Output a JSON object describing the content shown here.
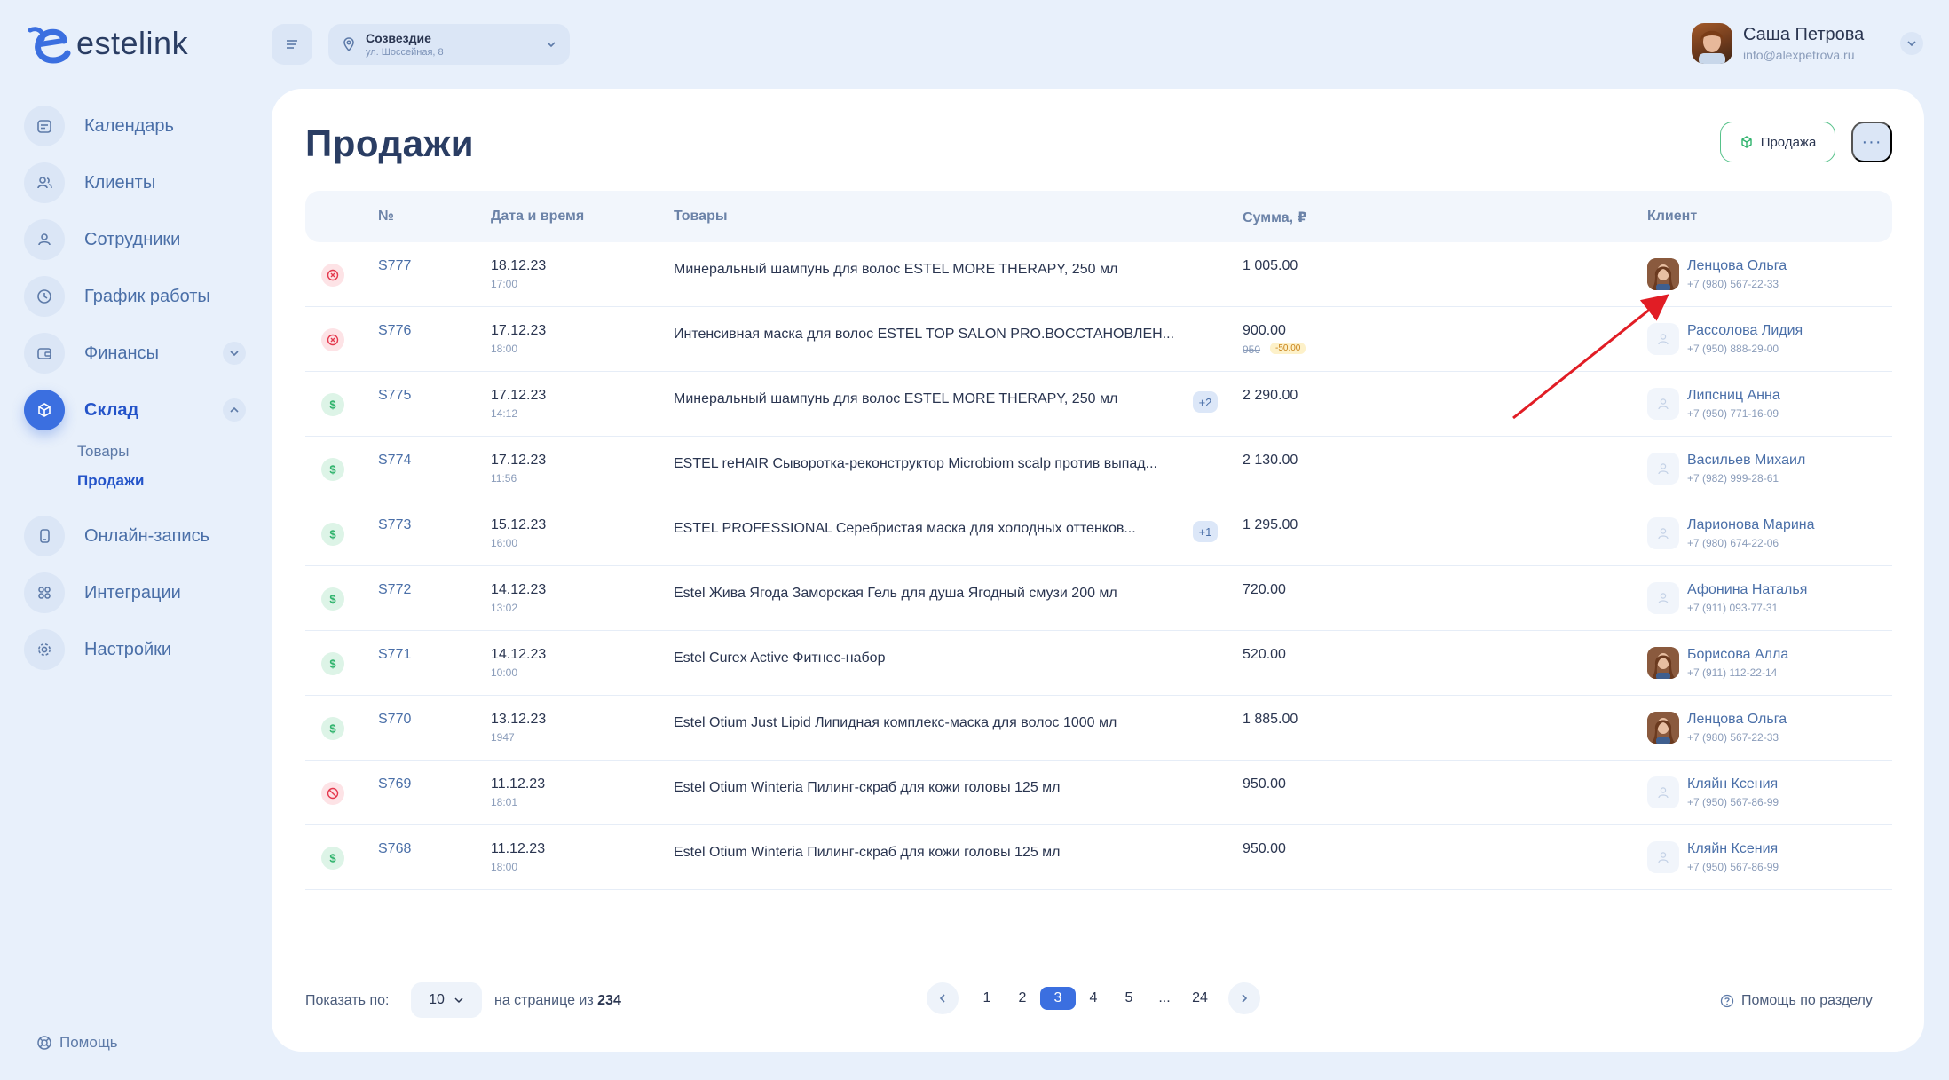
{
  "brand": {
    "name": "estelink"
  },
  "nav": {
    "calendar": "Календарь",
    "clients": "Клиенты",
    "staff": "Сотрудники",
    "schedule": "График работы",
    "finance": "Финансы",
    "warehouse": "Склад",
    "warehouse_sub": {
      "goods": "Товары",
      "sales": "Продажи"
    },
    "online_booking": "Онлайн-запись",
    "integrations": "Интеграции",
    "settings": "Настройки",
    "help": "Помощь"
  },
  "location": {
    "name": "Созвездие",
    "address": "ул. Шоссейная, 8"
  },
  "user": {
    "name": "Саша Петрова",
    "email": "info@alexpetrova.ru"
  },
  "page": {
    "title": "Продажи",
    "sale_button": "Продажа",
    "more_button": "···"
  },
  "table": {
    "headers": {
      "num": "№",
      "date": "Дата и время",
      "goods": "Товары",
      "sum": "Сумма, ₽",
      "client": "Клиент"
    },
    "rows": [
      {
        "status": "cancel",
        "num": "S777",
        "date": "18.12.23",
        "time": "17:00",
        "product": "Минеральный шампунь для волос ESTEL MORE THERAPY, 250 мл",
        "extra": "",
        "sum": "1 005.00",
        "old_sum": "",
        "discount": "",
        "avatar": "photo",
        "client": "Ленцова Ольга",
        "phone": "+7 (980) 567-22-33"
      },
      {
        "status": "cancel",
        "num": "S776",
        "date": "17.12.23",
        "time": "18:00",
        "product": "Интенсивная маска для волос ESTEL TOP SALON PRO.ВОССТАНОВЛЕН...",
        "extra": "",
        "sum": "900.00",
        "old_sum": "950",
        "discount": "-50.00",
        "avatar": "blank",
        "client": "Рассолова Лидия",
        "phone": "+7 (950) 888-29-00"
      },
      {
        "status": "paid",
        "num": "S775",
        "date": "17.12.23",
        "time": "14:12",
        "product": "Минеральный шампунь для волос ESTEL MORE THERAPY, 250 мл",
        "extra": "+2",
        "sum": "2 290.00",
        "old_sum": "",
        "discount": "",
        "avatar": "blank",
        "client": "Липсниц Анна",
        "phone": "+7 (950) 771-16-09"
      },
      {
        "status": "paid",
        "num": "S774",
        "date": "17.12.23",
        "time": "11:56",
        "product": "ESTEL reHAIR Сыворотка-реконструктор Microbiom scalp против выпад...",
        "extra": "",
        "sum": "2 130.00",
        "old_sum": "",
        "discount": "",
        "avatar": "blank",
        "client": "Васильев Михаил",
        "phone": "+7 (982) 999-28-61"
      },
      {
        "status": "paid",
        "num": "S773",
        "date": "15.12.23",
        "time": "16:00",
        "product": "ESTEL PROFESSIONAL Серебристая маска для холодных оттенков...",
        "extra": "+1",
        "sum": "1 295.00",
        "old_sum": "",
        "discount": "",
        "avatar": "blank",
        "client": "Ларионова Марина",
        "phone": "+7 (980) 674-22-06"
      },
      {
        "status": "paid",
        "num": "S772",
        "date": "14.12.23",
        "time": "13:02",
        "product": "Estel Жива Ягода Заморская Гель для душа Ягодный смузи 200 мл",
        "extra": "",
        "sum": "720.00",
        "old_sum": "",
        "discount": "",
        "avatar": "blank",
        "client": "Афонина Наталья",
        "phone": "+7 (911) 093-77-31"
      },
      {
        "status": "paid",
        "num": "S771",
        "date": "14.12.23",
        "time": "10:00",
        "product": "Estel Curex Active Фитнес-набор",
        "extra": "",
        "sum": "520.00",
        "old_sum": "",
        "discount": "",
        "avatar": "photo",
        "client": "Борисова Алла",
        "phone": "+7 (911) 112-22-14"
      },
      {
        "status": "paid",
        "num": "S770",
        "date": "13.12.23",
        "time": "1947",
        "product": "Estel Otium Just Lipid Липидная комплекс-маска для волос 1000 мл",
        "extra": "",
        "sum": "1 885.00",
        "old_sum": "",
        "discount": "",
        "avatar": "photo",
        "client": "Ленцова Ольга",
        "phone": "+7 (980) 567-22-33"
      },
      {
        "status": "blocked",
        "num": "S769",
        "date": "11.12.23",
        "time": "18:01",
        "product": "Estel Otium Winteria Пилинг-скраб для кожи головы 125 мл",
        "extra": "",
        "sum": "950.00",
        "old_sum": "",
        "discount": "",
        "avatar": "blank",
        "client": "Кляйн Ксения",
        "phone": "+7 (950) 567-86-99"
      },
      {
        "status": "paid",
        "num": "S768",
        "date": "11.12.23",
        "time": "18:00",
        "product": "Estel Otium Winteria Пилинг-скраб для кожи головы 125 мл",
        "extra": "",
        "sum": "950.00",
        "old_sum": "",
        "discount": "",
        "avatar": "blank",
        "client": "Кляйн Ксения",
        "phone": "+7 (950) 567-86-99"
      }
    ]
  },
  "footer": {
    "show_label": "Показать по:",
    "per_page": "10",
    "on_page_prefix": "на странице из",
    "total": "234",
    "pages": [
      "1",
      "2",
      "3",
      "4",
      "5",
      "...",
      "24"
    ],
    "current_page": "3",
    "help": "Помощь по разделу"
  },
  "colors": {
    "accent": "#3b6fe0",
    "success": "#2fb36c",
    "danger": "#e4384d",
    "annotation_arrow": "#e11d25"
  },
  "icons": {
    "calendar": "calendar-icon",
    "clients": "users-icon",
    "staff": "user-icon",
    "schedule": "clock-icon",
    "finance": "wallet-icon",
    "warehouse": "box-icon",
    "online_booking": "phone-icon",
    "integrations": "grid-icon",
    "settings": "gear-icon",
    "help": "lifebuoy-icon"
  }
}
